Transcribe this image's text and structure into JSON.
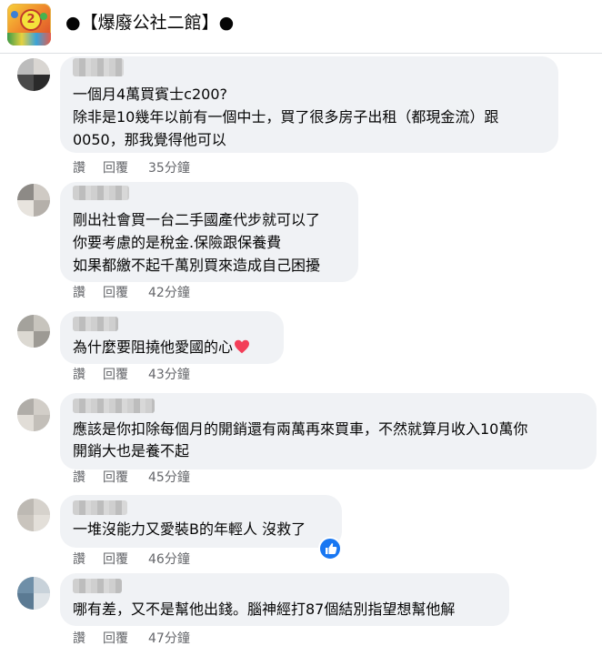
{
  "header": {
    "title": "●【爆廢公社二館】●",
    "logo_icon": "page-logo-icon"
  },
  "comments": [
    {
      "lines": [
        "一個月4萬買賓士c200?",
        "除非是10幾年以前有一個中士，買了很多房子出租（都現金流）跟",
        "0050，那我覺得他可以"
      ],
      "like": "讚",
      "reply": "回覆",
      "time": "35分鐘"
    },
    {
      "lines": [
        "剛出社會買一台二手國產代步就可以了",
        "你要考慮的是稅金.保險跟保養費",
        "如果都繳不起千萬別買來造成自己困擾"
      ],
      "like": "讚",
      "reply": "回覆",
      "time": "42分鐘"
    },
    {
      "lines": [
        "為什麼要阻撓他愛國的心"
      ],
      "reaction": "heart-icon",
      "like": "讚",
      "reply": "回覆",
      "time": "43分鐘"
    },
    {
      "lines": [
        "應該是你扣除每個月的開銷還有兩萬再來買車，不然就算月收入10萬你",
        "開銷大也是養不起"
      ],
      "like": "讚",
      "reply": "回覆",
      "time": "45分鐘"
    },
    {
      "lines": [
        "一堆沒能力又愛裝B的年輕人 沒救了"
      ],
      "reaction": "thumbs-up-reaction-icon",
      "like": "讚",
      "reply": "回覆",
      "time": "46分鐘"
    },
    {
      "lines": [
        "哪有差，又不是幫他出錢。腦神經打87個結別指望想幫他解"
      ],
      "like": "讚",
      "reply": "回覆",
      "time": "47分鐘"
    }
  ],
  "colors": {
    "bubble": "#f0f2f5",
    "meta_text": "#65676b",
    "heart": "#f33e58",
    "like_blue": "#1877f2"
  }
}
